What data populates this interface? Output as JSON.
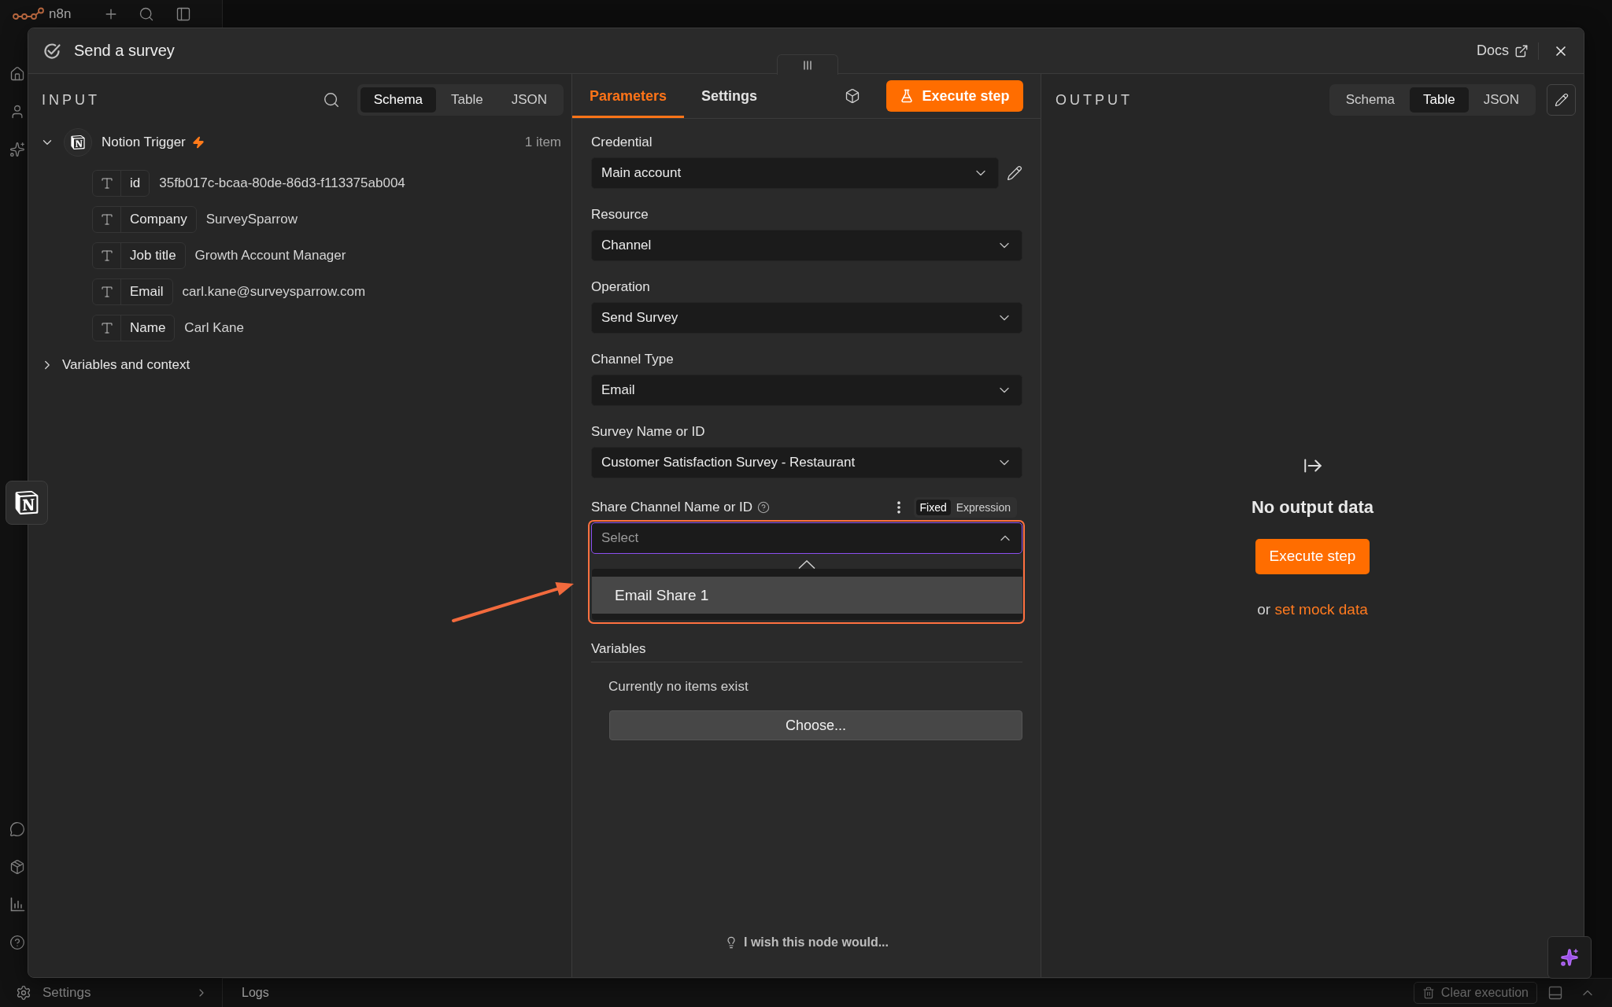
{
  "app": {
    "logo": "n8n",
    "settings": "Settings",
    "logs": "Logs",
    "clear_button": "Clear execution"
  },
  "modal": {
    "title": "Send a survey",
    "docs": "Docs"
  },
  "input": {
    "heading": "INPUT",
    "views": [
      {
        "label": "Schema",
        "selected": true
      },
      {
        "label": "Table",
        "selected": false
      },
      {
        "label": "JSON",
        "selected": false
      }
    ],
    "node": {
      "name": "Notion Trigger",
      "count": "1 item",
      "expanded": true,
      "fields": [
        {
          "key": "id",
          "value": "35fb017c-bcaa-80de-86d3-f113375ab004"
        },
        {
          "key": "Company",
          "value": "SurveySparrow"
        },
        {
          "key": "Job title",
          "value": "Growth Account Manager"
        },
        {
          "key": "Email",
          "value": "carl.kane@surveysparrow.com"
        },
        {
          "key": "Name",
          "value": "Carl Kane"
        }
      ]
    },
    "context": {
      "label": "Variables and context",
      "expanded": false
    }
  },
  "parameters": {
    "tabs": [
      {
        "label": "Parameters",
        "selected": true
      },
      {
        "label": "Settings",
        "selected": false
      }
    ],
    "execute_button": "Execute step",
    "fields": [
      {
        "kind": "credential",
        "label": "Credential",
        "value": "Main account"
      },
      {
        "kind": "select",
        "label": "Resource",
        "value": "Channel"
      },
      {
        "kind": "select",
        "label": "Operation",
        "value": "Send Survey"
      },
      {
        "kind": "select",
        "label": "Channel Type",
        "value": "Email"
      },
      {
        "kind": "select",
        "label": "Survey Name or ID",
        "value": "Customer Satisfaction Survey - Restaurant"
      }
    ],
    "share_channel": {
      "label": "Share Channel Name or ID",
      "modes": [
        {
          "label": "Fixed",
          "selected": true
        },
        {
          "label": "Expression",
          "selected": false
        }
      ],
      "placeholder": "Select",
      "focused": true,
      "open": true,
      "annotated": true,
      "options": [
        {
          "label": "Email Share 1",
          "highlighted": true
        }
      ]
    },
    "variables": {
      "label": "Variables",
      "empty_text": "Currently no items exist",
      "button": "Choose..."
    },
    "feedback": "I wish this node would..."
  },
  "output": {
    "heading": "OUTPUT",
    "views": [
      {
        "label": "Schema",
        "selected": false
      },
      {
        "label": "Table",
        "selected": true
      },
      {
        "label": "JSON",
        "selected": false
      }
    ],
    "empty_title": "No output data",
    "execute_button": "Execute step",
    "hint": {
      "prefix": "or",
      "link": "set mock data"
    }
  }
}
